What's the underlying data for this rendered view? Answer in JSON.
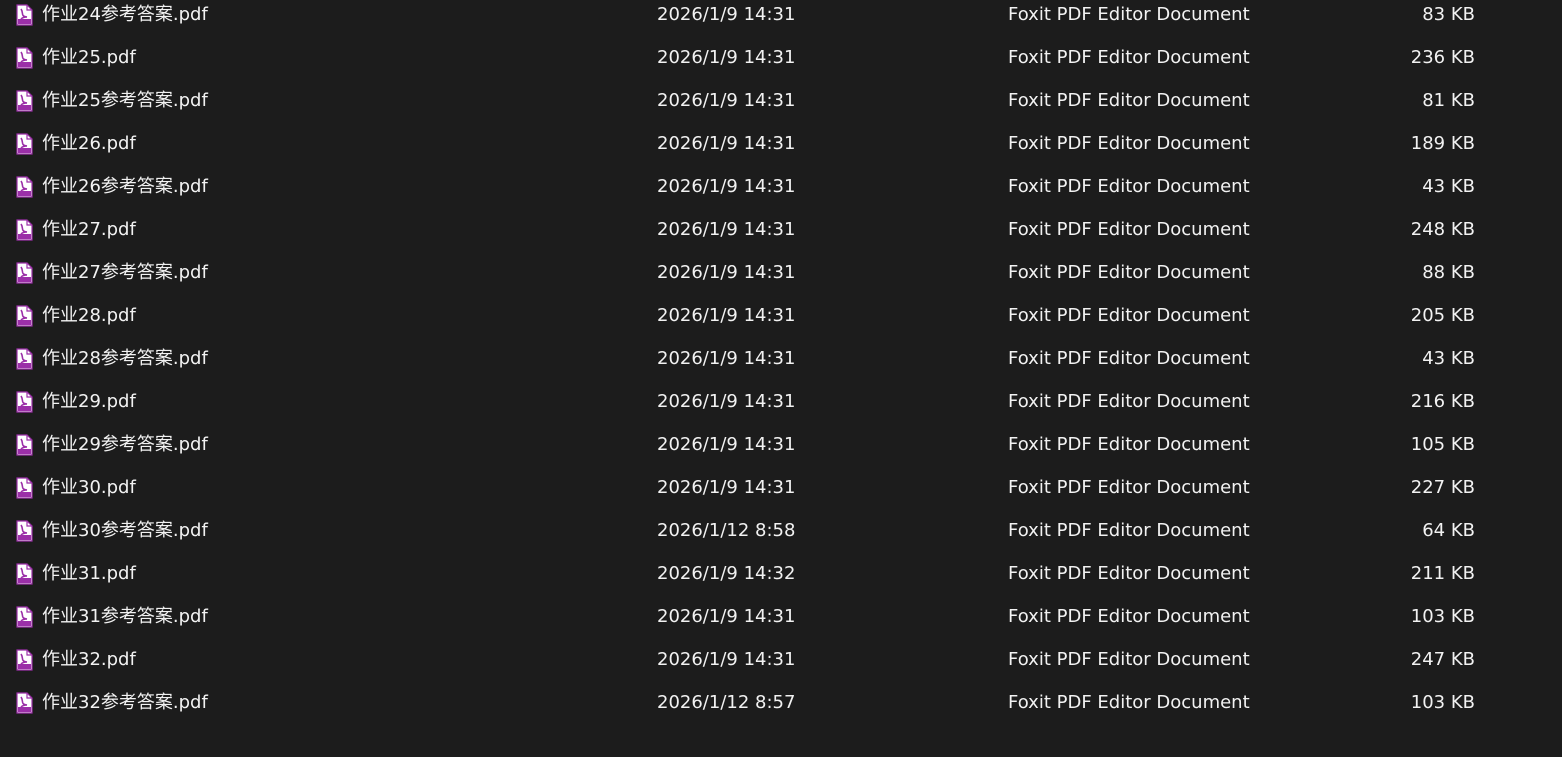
{
  "files": [
    {
      "name": "作业24参考答案.pdf",
      "date": "2026/1/9 14:31",
      "type": "Foxit PDF Editor Document",
      "size": "83 KB",
      "icon": "pdf-file-icon"
    },
    {
      "name": "作业25.pdf",
      "date": "2026/1/9 14:31",
      "type": "Foxit PDF Editor Document",
      "size": "236 KB",
      "icon": "pdf-file-icon"
    },
    {
      "name": "作业25参考答案.pdf",
      "date": "2026/1/9 14:31",
      "type": "Foxit PDF Editor Document",
      "size": "81 KB",
      "icon": "pdf-file-icon"
    },
    {
      "name": "作业26.pdf",
      "date": "2026/1/9 14:31",
      "type": "Foxit PDF Editor Document",
      "size": "189 KB",
      "icon": "pdf-file-icon"
    },
    {
      "name": "作业26参考答案.pdf",
      "date": "2026/1/9 14:31",
      "type": "Foxit PDF Editor Document",
      "size": "43 KB",
      "icon": "pdf-file-icon"
    },
    {
      "name": "作业27.pdf",
      "date": "2026/1/9 14:31",
      "type": "Foxit PDF Editor Document",
      "size": "248 KB",
      "icon": "pdf-file-icon"
    },
    {
      "name": "作业27参考答案.pdf",
      "date": "2026/1/9 14:31",
      "type": "Foxit PDF Editor Document",
      "size": "88 KB",
      "icon": "pdf-file-icon"
    },
    {
      "name": "作业28.pdf",
      "date": "2026/1/9 14:31",
      "type": "Foxit PDF Editor Document",
      "size": "205 KB",
      "icon": "pdf-file-icon"
    },
    {
      "name": "作业28参考答案.pdf",
      "date": "2026/1/9 14:31",
      "type": "Foxit PDF Editor Document",
      "size": "43 KB",
      "icon": "pdf-file-icon"
    },
    {
      "name": "作业29.pdf",
      "date": "2026/1/9 14:31",
      "type": "Foxit PDF Editor Document",
      "size": "216 KB",
      "icon": "pdf-file-icon"
    },
    {
      "name": "作业29参考答案.pdf",
      "date": "2026/1/9 14:31",
      "type": "Foxit PDF Editor Document",
      "size": "105 KB",
      "icon": "pdf-file-icon"
    },
    {
      "name": "作业30.pdf",
      "date": "2026/1/9 14:31",
      "type": "Foxit PDF Editor Document",
      "size": "227 KB",
      "icon": "pdf-file-icon"
    },
    {
      "name": "作业30参考答案.pdf",
      "date": "2026/1/12 8:58",
      "type": "Foxit PDF Editor Document",
      "size": "64 KB",
      "icon": "pdf-file-icon"
    },
    {
      "name": "作业31.pdf",
      "date": "2026/1/9 14:32",
      "type": "Foxit PDF Editor Document",
      "size": "211 KB",
      "icon": "pdf-file-icon"
    },
    {
      "name": "作业31参考答案.pdf",
      "date": "2026/1/9 14:31",
      "type": "Foxit PDF Editor Document",
      "size": "103 KB",
      "icon": "pdf-file-icon"
    },
    {
      "name": "作业32.pdf",
      "date": "2026/1/9 14:31",
      "type": "Foxit PDF Editor Document",
      "size": "247 KB",
      "icon": "pdf-file-icon"
    },
    {
      "name": "作业32参考答案.pdf",
      "date": "2026/1/12 8:57",
      "type": "Foxit PDF Editor Document",
      "size": "103 KB",
      "icon": "pdf-file-icon"
    }
  ],
  "colors": {
    "background": "#1c1c1c",
    "text": "#f2f2f2",
    "pdf_icon_accent": "#9b2fa8"
  }
}
